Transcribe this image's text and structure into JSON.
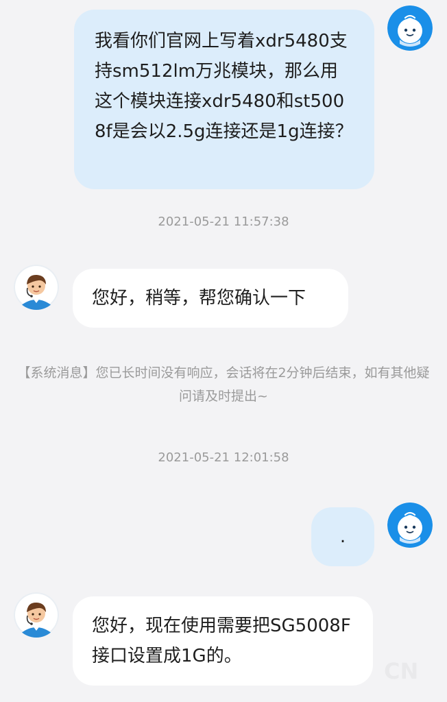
{
  "colors": {
    "background": "#f3f3f5",
    "user_bubble": "#dcedfb",
    "agent_bubble": "#ffffff",
    "meta_text": "#9a9a9a",
    "bot_avatar_bg": "#1a8fe8"
  },
  "messages": [
    {
      "sender": "user",
      "avatar_icon": "bot-avatar-icon",
      "text": "我看你们官网上写着xdr5480支持sm512lm万兆模块，那么用这个模块连接xdr5480和st5008f是会以2.5g连接还是1g连接？"
    },
    {
      "type": "timestamp",
      "text": "2021-05-21 11:57:38"
    },
    {
      "sender": "agent",
      "avatar_icon": "agent-avatar-icon",
      "text": "您好，稍等，帮您确认一下"
    },
    {
      "type": "system",
      "text": "【系统消息】您已长时间没有响应，会话将在2分钟后结束，如有其他疑问请及时提出~"
    },
    {
      "type": "timestamp",
      "text": "2021-05-21 12:01:58"
    },
    {
      "sender": "user",
      "avatar_icon": "bot-avatar-icon",
      "text": "."
    },
    {
      "sender": "agent",
      "avatar_icon": "agent-avatar-icon",
      "text": "您好，现在使用需要把SG5008F接口设置成1G的。"
    }
  ]
}
